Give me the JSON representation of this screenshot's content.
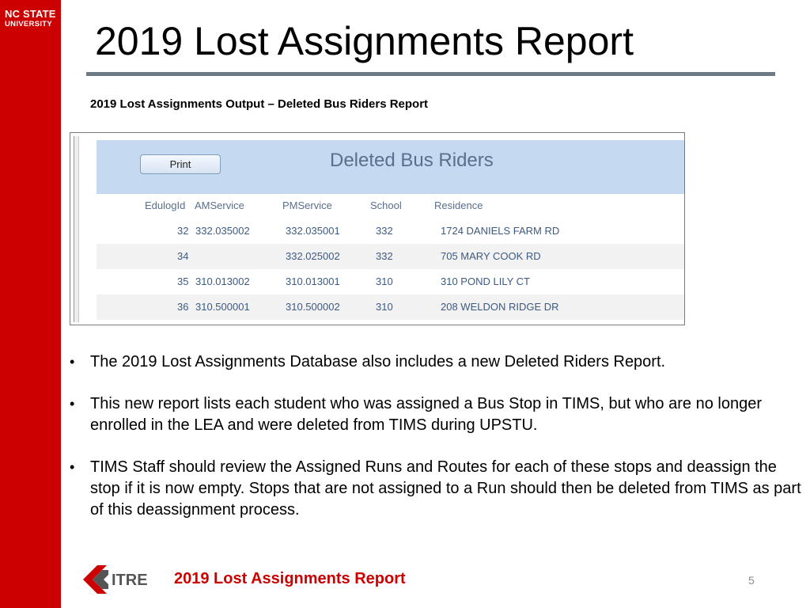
{
  "logo": {
    "line1": "NC STATE",
    "line2": "UNIVERSITY"
  },
  "title": "2019 Lost Assignments Report",
  "subtitle": "2019 Lost Assignments Output – Deleted Bus Riders Report",
  "report": {
    "print_label": "Print",
    "title": "Deleted Bus Riders",
    "columns": [
      "EdulogId",
      "AMService",
      "PMService",
      "School",
      "Residence"
    ],
    "rows": [
      {
        "edulogid": "32",
        "amservice": "332.035002",
        "pmservice": "332.035001",
        "school": "332",
        "residence": "1724 DANIELS FARM RD"
      },
      {
        "edulogid": "34",
        "amservice": "",
        "pmservice": "332.025002",
        "school": "332",
        "residence": "705 MARY COOK RD"
      },
      {
        "edulogid": "35",
        "amservice": "310.013002",
        "pmservice": "310.013001",
        "school": "310",
        "residence": "310 POND LILY CT"
      },
      {
        "edulogid": "36",
        "amservice": "310.500001",
        "pmservice": "310.500002",
        "school": "310",
        "residence": "208 WELDON RIDGE DR"
      }
    ]
  },
  "bullets": [
    "The 2019 Lost Assignments Database also includes a new Deleted Riders Report.",
    "This new report lists each student who was assigned a Bus Stop in TIMS, but who are no longer enrolled in the LEA and were deleted from TIMS during UPSTU.",
    "TIMS Staff should review the Assigned Runs and Routes for each of these stops and deassign the stop if it is now empty. Stops that are not assigned to a Run should then be deleted from TIMS as part of this deassignment process."
  ],
  "footer": {
    "logo_text": "ITRE",
    "title": "2019 Lost Assignments Report",
    "page": "5"
  },
  "colors": {
    "brand_red": "#cc0000",
    "header_blue": "#c5d9f1",
    "rule_gray": "#6d7a86"
  }
}
